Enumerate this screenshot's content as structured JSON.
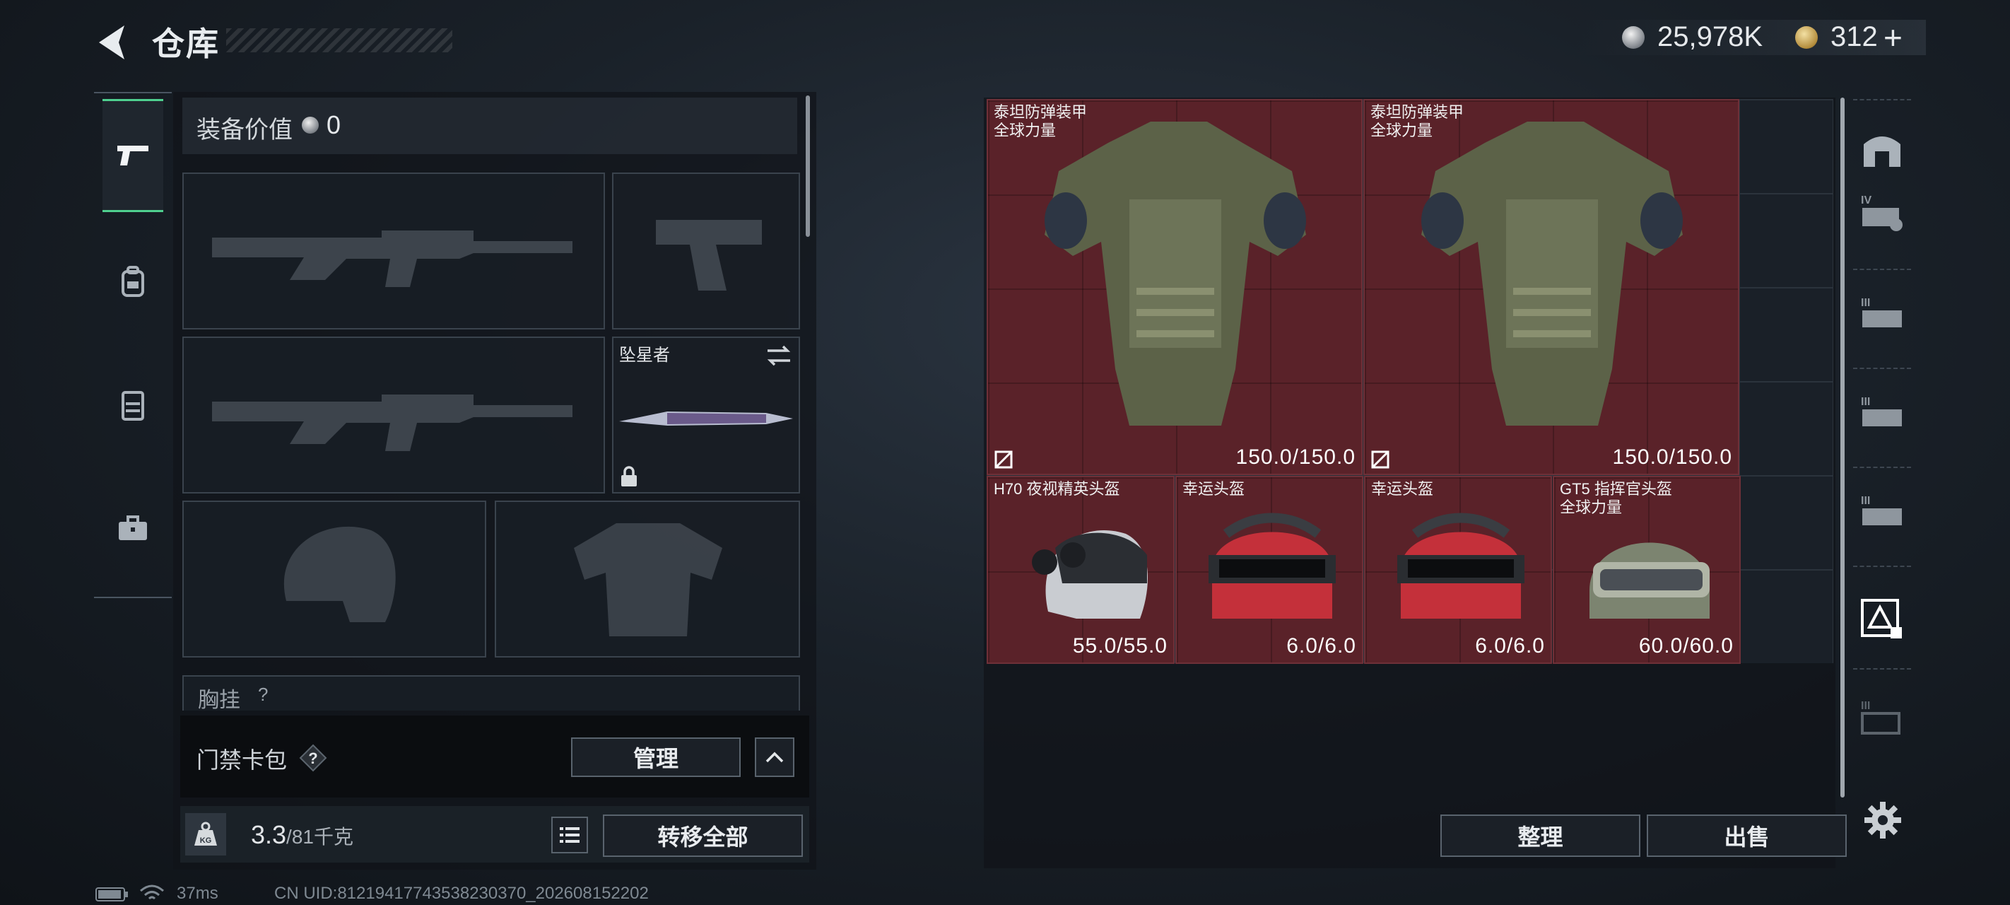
{
  "header": {
    "title": "仓库",
    "currency_silver": "25,978K",
    "currency_gold": "312",
    "currency_plus": "+"
  },
  "left_tabs": [
    "weapons-tab",
    "backpack-tab",
    "vest-tab",
    "case-tab"
  ],
  "loadout": {
    "equip_value_label": "装备价值",
    "equip_value": "0",
    "melee_name": "坠星者",
    "chest_rig_label": "胸挂",
    "chest_rig_help": "?"
  },
  "keycard": {
    "label": "门禁卡包",
    "help": "?",
    "manage": "管理"
  },
  "weight": {
    "current": "3.3",
    "max": "/81千克",
    "transfer_all": "转移全部"
  },
  "status": {
    "ping": "37ms",
    "uid": "CN UID:8121941774353823037​0_202608152202"
  },
  "storage": {
    "items": [
      {
        "name1": "泰坦防弹装甲",
        "name2": "全球力量",
        "durability": "150.0/150.0"
      },
      {
        "name1": "泰坦防弹装甲",
        "name2": "全球力量",
        "durability": "150.0/150.0"
      },
      {
        "name1": "H70 夜视精英头盔",
        "name2": "",
        "durability": "55.0/55.0"
      },
      {
        "name1": "幸运头盔",
        "name2": "",
        "durability": "6.0/6.0"
      },
      {
        "name1": "幸运头盔",
        "name2": "",
        "durability": "6.0/6.0"
      },
      {
        "name1": "GT5 指挥官头盔",
        "name2": "全球力量",
        "durability": "60.0/60.0"
      }
    ],
    "sort": "整理",
    "sell": "出售"
  },
  "colors": {
    "accent_green": "#4fd08f",
    "item_bg": "#5a2229"
  }
}
